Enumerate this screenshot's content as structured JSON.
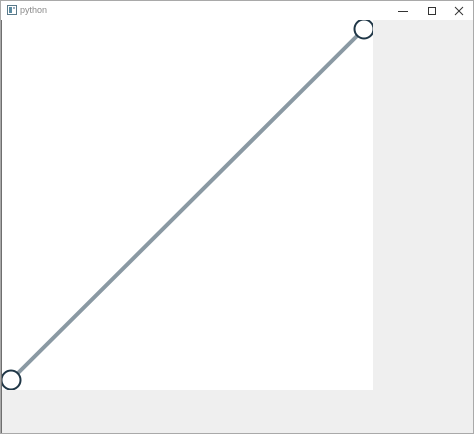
{
  "window": {
    "title": "python",
    "controls": {
      "minimize_icon": "minimize-icon",
      "maximize_icon": "maximize-icon",
      "close_icon": "close-icon"
    }
  },
  "canvas": {
    "background": "#ffffff",
    "line_color": "#8a99a3",
    "handle_stroke_color": "#1f3646",
    "handle_fill_color": "#ffffff"
  },
  "colors": {
    "window_background": "#efefef",
    "titlebar_background": "#ffffff",
    "title_text": "#8a8a8a"
  }
}
